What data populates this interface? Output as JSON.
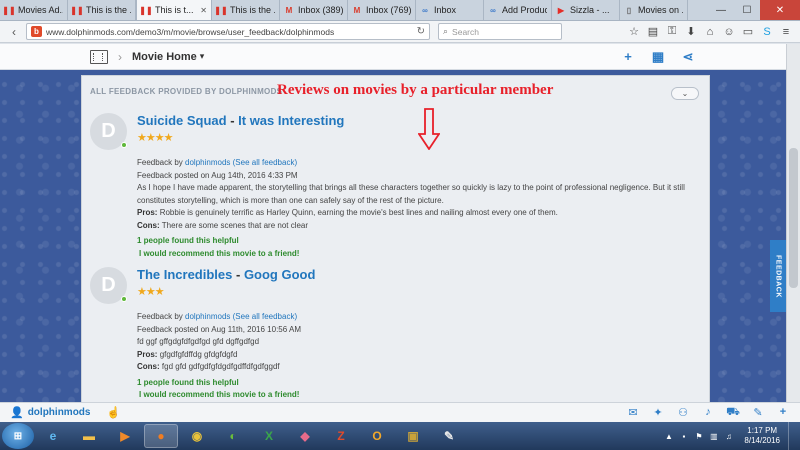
{
  "browser": {
    "tabs": [
      {
        "label": "Movies Ad...",
        "icon": "bar-icon",
        "color": "#d9342b",
        "active": false
      },
      {
        "label": "This is the ...",
        "icon": "bar-icon",
        "color": "#d9342b",
        "active": false
      },
      {
        "label": "This is t...",
        "icon": "bar-icon",
        "color": "#d9342b",
        "active": true
      },
      {
        "label": "This is the ...",
        "icon": "bar-icon",
        "color": "#d9342b",
        "active": false
      },
      {
        "label": "Inbox (389)...",
        "icon": "gmail-icon",
        "color": "#d93b2b",
        "active": false
      },
      {
        "label": "Inbox (769)...",
        "icon": "gmail-icon",
        "color": "#d93b2b",
        "active": false
      },
      {
        "label": "Inbox",
        "icon": "link-icon",
        "color": "#3b78c9",
        "active": false
      },
      {
        "label": "Add Product",
        "icon": "link-icon",
        "color": "#3b78c9",
        "active": false
      },
      {
        "label": "Sizzla - ...",
        "icon": "youtube-icon",
        "color": "#e52d27",
        "active": false
      },
      {
        "label": "Movies on ...",
        "icon": "page-icon",
        "color": "#666666",
        "active": false
      }
    ],
    "url": "www.dolphinmods.com/demo3/m/movie/browse/user_feedback/dolphinmods",
    "search_placeholder": "Search"
  },
  "header": {
    "title": "Movie Home"
  },
  "panel": {
    "label": "ALL FEEDBACK PROVIDED BY DOLPHINMODS",
    "annotation": "Reviews on movies by a particular  member"
  },
  "reviews": [
    {
      "avatar_letter": "D",
      "movie": "Suicide Squad",
      "separator": " - ",
      "headline": "It was Interesting",
      "stars": "★★★★",
      "feedback_by_prefix": "Feedback by ",
      "author": "dolphinmods",
      "see_all": "(See all feedback)",
      "posted": "Feedback posted on Aug 14th, 2016 4:33 PM",
      "text": "As I hope I have made apparent, the storytelling that brings all these characters together so quickly is lazy to the point of professional negligence. But it still constitutes storytelling, which is more than one can safely say of the rest of the picture.",
      "pros_label": "Pros:",
      "pros": "Robbie is genuinely terrific as Harley Quinn, earning the movie's best lines and nailing almost every one of them.",
      "cons_label": "Cons:",
      "cons": "There are some scenes that are not clear",
      "helpful": "1 people found this helpful",
      "recommend": "I would recommend this movie to a friend!"
    },
    {
      "avatar_letter": "D",
      "movie": "The Incredibles",
      "separator": " - ",
      "headline": "Goog Good",
      "stars": "★★★",
      "feedback_by_prefix": "Feedback by ",
      "author": "dolphinmods",
      "see_all": "(See all feedback)",
      "posted": "Feedback posted on Aug 11th, 2016 10:56 AM",
      "text": "fd ggf gffgdgfdfgdfgd gfd dgffgdfgd",
      "pros_label": "Pros:",
      "pros": "gfgdfgfdffdg gfdgfdgfd",
      "cons_label": "Cons:",
      "cons": "fgd gfd gdfgdfgfdgdfgdffdfgdfggdf",
      "helpful": "1 people found this helpful",
      "recommend": "I would recommend this movie to a friend!"
    }
  ],
  "feedback_tab": "FEEDBACK",
  "sitebar": {
    "username": "dolphinmods"
  },
  "taskbar": {
    "time": "1:17 PM",
    "date": "8/14/2016"
  },
  "colors": {
    "accent": "#2176bd",
    "annotation": "#e8202a",
    "green": "#2e8b2e",
    "star": "#f0a81c"
  }
}
